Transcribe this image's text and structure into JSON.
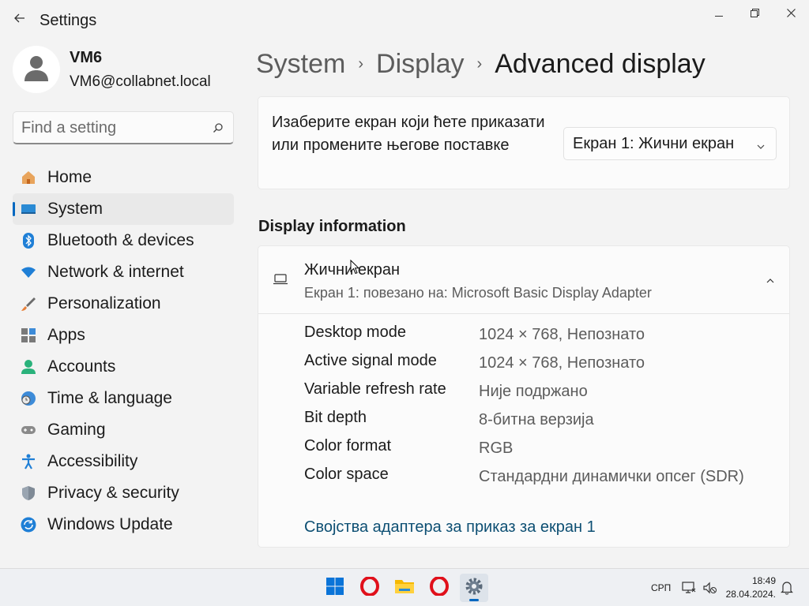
{
  "window": {
    "title": "Settings",
    "back_icon": "back-arrow-icon",
    "minimize_icon": "minimize-icon",
    "maximize_icon": "restore-icon",
    "close_icon": "close-icon"
  },
  "profile": {
    "name": "VM6",
    "email": "VM6@collabnet.local",
    "avatar_icon": "user-avatar-icon"
  },
  "search": {
    "placeholder": "Find a setting",
    "value": "",
    "icon": "search-icon"
  },
  "sidebar": {
    "items": [
      {
        "label": "Home",
        "icon": "home-icon",
        "active": false
      },
      {
        "label": "System",
        "icon": "system-display-icon",
        "active": true
      },
      {
        "label": "Bluetooth & devices",
        "icon": "bluetooth-icon",
        "active": false
      },
      {
        "label": "Network & internet",
        "icon": "wifi-icon",
        "active": false
      },
      {
        "label": "Personalization",
        "icon": "brush-icon",
        "active": false
      },
      {
        "label": "Apps",
        "icon": "apps-icon",
        "active": false
      },
      {
        "label": "Accounts",
        "icon": "accounts-icon",
        "active": false
      },
      {
        "label": "Time & language",
        "icon": "globe-clock-icon",
        "active": false
      },
      {
        "label": "Gaming",
        "icon": "gamepad-icon",
        "active": false
      },
      {
        "label": "Accessibility",
        "icon": "accessibility-icon",
        "active": false
      },
      {
        "label": "Privacy & security",
        "icon": "shield-icon",
        "active": false
      },
      {
        "label": "Windows Update",
        "icon": "windows-update-icon",
        "active": false
      }
    ],
    "accent_color": "#0067c0"
  },
  "breadcrumb": {
    "items": [
      "System",
      "Display",
      "Advanced display"
    ]
  },
  "select_display": {
    "text": "Изаберите екран који ћете приказати или промените његове поставке",
    "dropdown_value": "Екран 1: Жични екран",
    "dropdown_icon": "chevron-down-icon"
  },
  "display_information": {
    "section_title": "Display information",
    "display_name": "Жични екран",
    "display_subtitle": "Екран 1: повезано на: Microsoft Basic Display Adapter",
    "expander_icon": "chevron-up-icon",
    "monitor_icon": "monitor-icon",
    "rows": [
      {
        "key": "Desktop mode",
        "value": "1024 × 768, Непознато"
      },
      {
        "key": "Active signal mode",
        "value": "1024 × 768, Непознато"
      },
      {
        "key": "Variable refresh rate",
        "value": "Није подржано"
      },
      {
        "key": "Bit depth",
        "value": "8-битна верзија"
      },
      {
        "key": "Color format",
        "value": "RGB"
      },
      {
        "key": "Color space",
        "value": "Стандардни динамички опсег (SDR)"
      }
    ],
    "adapter_link": "Својства адаптера за приказ за екран 1"
  },
  "taskbar": {
    "apps": [
      {
        "name": "start",
        "icon": "windows-start-icon"
      },
      {
        "name": "opera",
        "icon": "opera-icon"
      },
      {
        "name": "file-explorer",
        "icon": "folder-icon"
      },
      {
        "name": "opera-2",
        "icon": "opera-icon"
      },
      {
        "name": "settings",
        "icon": "gear-icon"
      }
    ],
    "language": "СРП",
    "time": "18:49",
    "date": "28.04.2024.",
    "tray_icons": [
      "network-icon",
      "volume-muted-icon",
      "notification-bell-icon"
    ]
  }
}
